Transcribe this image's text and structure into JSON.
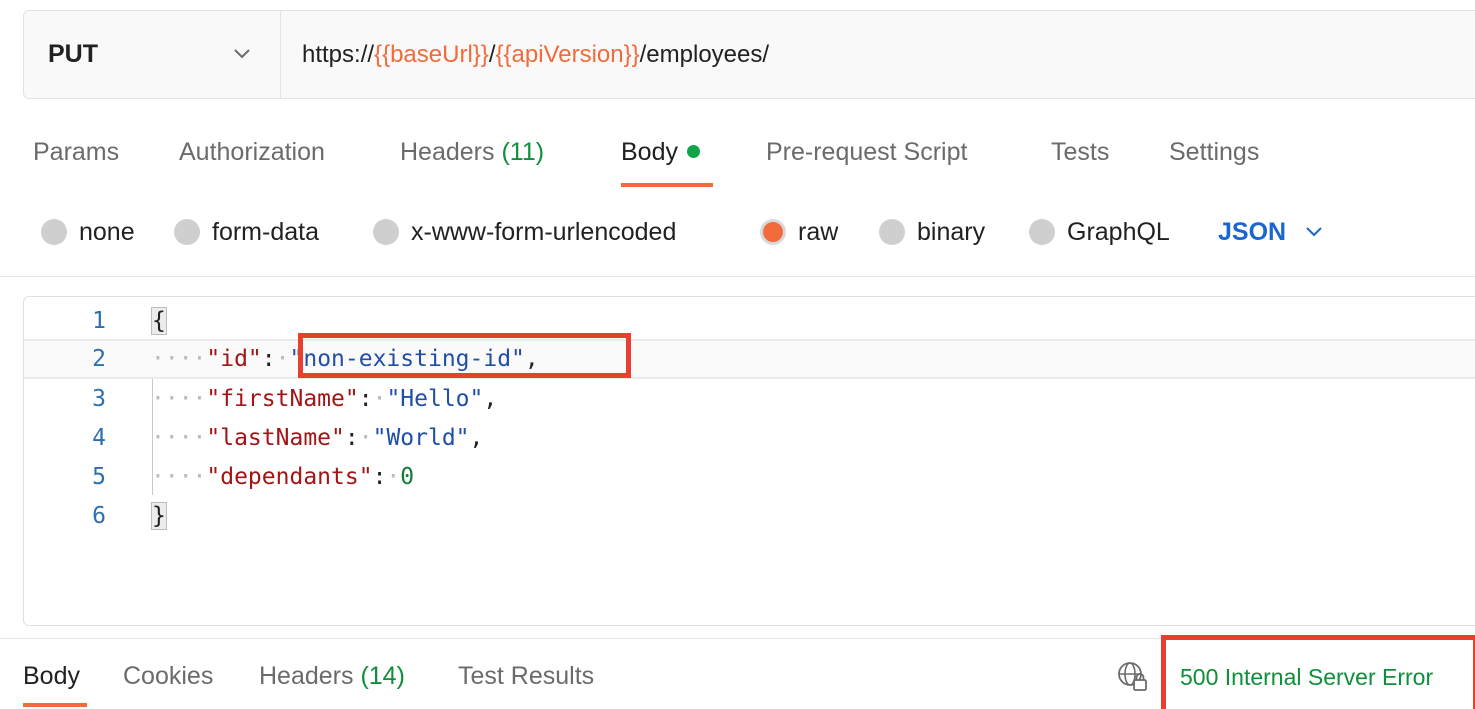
{
  "request": {
    "method": "PUT",
    "url_parts": [
      "https://",
      "{{baseUrl}}",
      "/",
      "{{apiVersion}}",
      "/employees/"
    ]
  },
  "request_tabs": [
    {
      "label": "Params"
    },
    {
      "label": "Authorization"
    },
    {
      "label": "Headers",
      "count": "(11)"
    },
    {
      "label": "Body",
      "active": true,
      "indicator": "green-dot"
    },
    {
      "label": "Pre-request Script"
    },
    {
      "label": "Tests"
    },
    {
      "label": "Settings"
    }
  ],
  "body_types": [
    {
      "label": "none"
    },
    {
      "label": "form-data"
    },
    {
      "label": "x-www-form-urlencoded"
    },
    {
      "label": "raw",
      "selected": true
    },
    {
      "label": "binary"
    },
    {
      "label": "GraphQL"
    }
  ],
  "body_format": "JSON",
  "editor": {
    "line_numbers": [
      "1",
      "2",
      "3",
      "4",
      "5",
      "6"
    ],
    "lines": [
      {
        "open": "{"
      },
      {
        "key": "\"id\"",
        "value": "\"non-existing-id\"",
        "value_type": "string",
        "trailing": ","
      },
      {
        "key": "\"firstName\"",
        "value": "\"Hello\"",
        "value_type": "string",
        "trailing": ","
      },
      {
        "key": "\"lastName\"",
        "value": "\"World\"",
        "value_type": "string",
        "trailing": ","
      },
      {
        "key": "\"dependants\"",
        "value": "0",
        "value_type": "number",
        "trailing": ""
      },
      {
        "close": "}"
      }
    ]
  },
  "response_tabs": [
    {
      "label": "Body",
      "active": true
    },
    {
      "label": "Cookies"
    },
    {
      "label": "Headers",
      "count": "(14)"
    },
    {
      "label": "Test Results"
    }
  ],
  "response": {
    "status": "500 Internal Server Error",
    "network_icon": "globe-lock-icon"
  },
  "colors": {
    "accent": "#f26b3a",
    "variable": "#f26b3a",
    "status_text": "#0f8f3a",
    "format_link": "#1a67d2",
    "annotation_box": "#e8402f"
  }
}
